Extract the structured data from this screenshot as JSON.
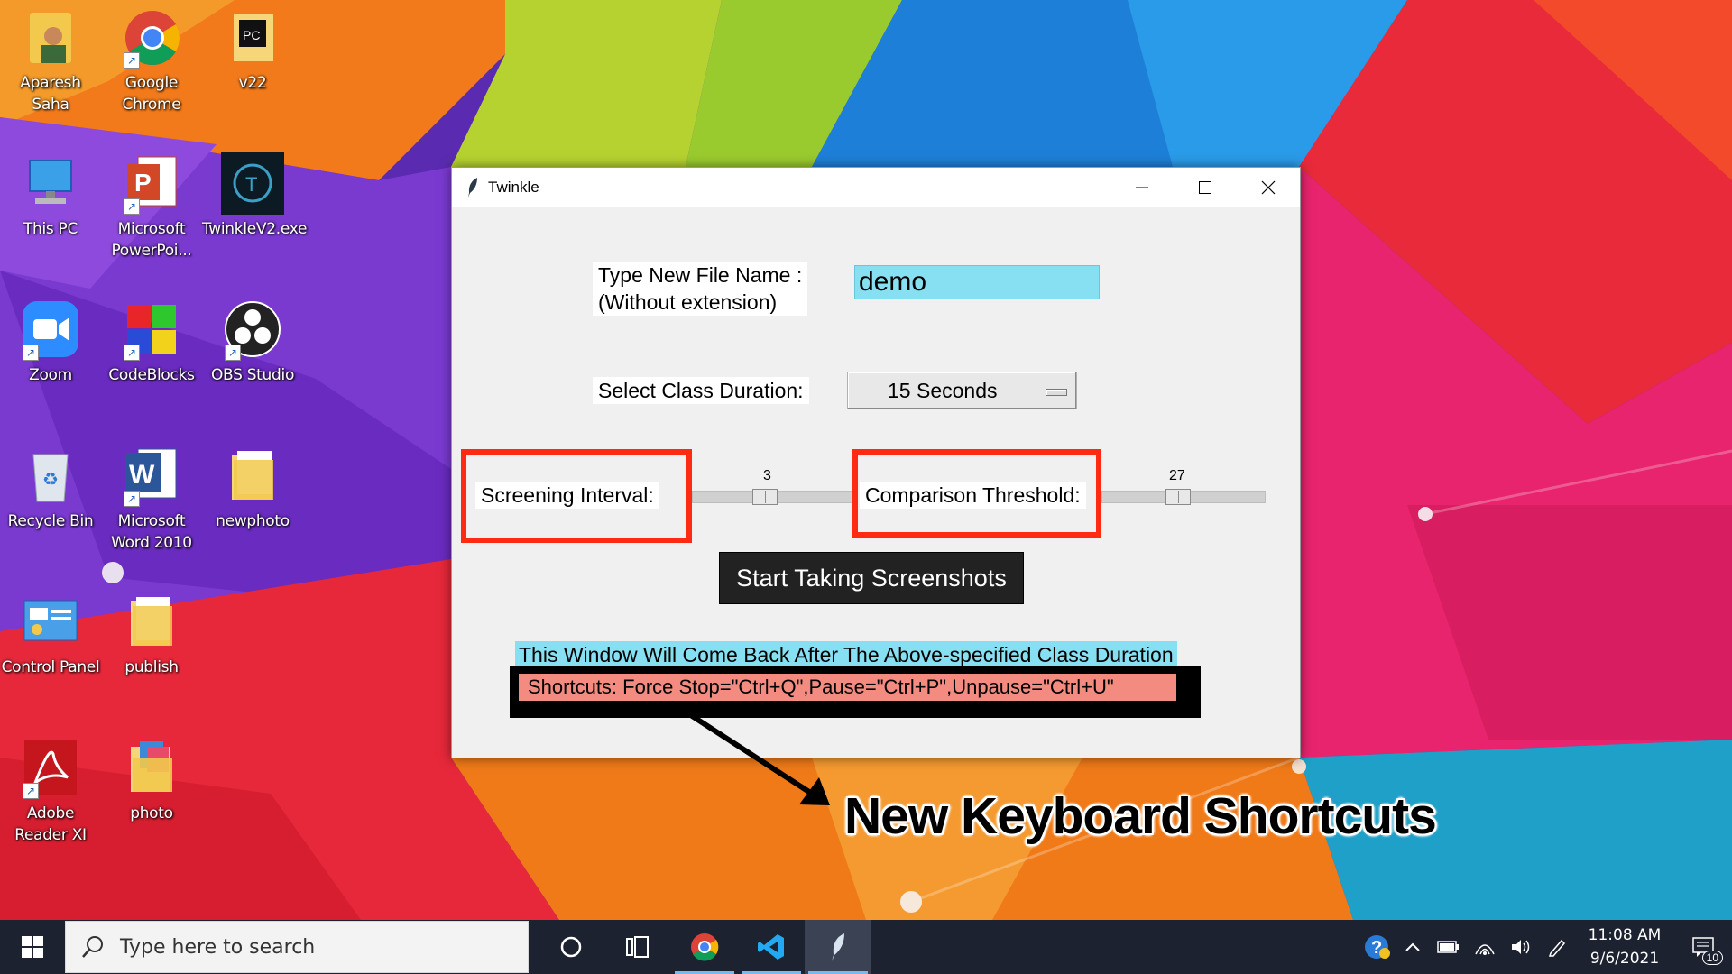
{
  "desktop": {
    "icons": [
      {
        "label_lines": [
          "Aparesh Saha"
        ]
      },
      {
        "label_lines": [
          "Google",
          "Chrome"
        ]
      },
      {
        "label_lines": [
          "v22"
        ]
      },
      {
        "label_lines": [
          "This PC"
        ]
      },
      {
        "label_lines": [
          "Microsoft",
          "PowerPoi..."
        ]
      },
      {
        "label_lines": [
          "TwinkleV2.exe"
        ]
      },
      {
        "label_lines": [
          "Zoom"
        ]
      },
      {
        "label_lines": [
          "CodeBlocks"
        ]
      },
      {
        "label_lines": [
          "OBS Studio"
        ]
      },
      {
        "label_lines": [
          "Recycle Bin"
        ]
      },
      {
        "label_lines": [
          "Microsoft",
          "Word 2010"
        ]
      },
      {
        "label_lines": [
          "newphoto"
        ]
      },
      {
        "label_lines": [
          "Control Panel"
        ]
      },
      {
        "label_lines": [
          "publish"
        ]
      },
      {
        "label_lines": [
          "Adobe",
          "Reader XI"
        ]
      },
      {
        "label_lines": [
          "photo"
        ]
      }
    ]
  },
  "window": {
    "title": "Twinkle",
    "filename_label_line1": "Type New File Name :",
    "filename_label_line2": "(Without extension)",
    "filename_value": "demo",
    "duration_label": "Select Class Duration:",
    "duration_value": "15 Seconds",
    "screening_label": "Screening Interval:",
    "screening_value": "3",
    "threshold_label": "Comparison Threshold:",
    "threshold_value": "27",
    "start_button": "Start Taking Screenshots",
    "info_text": "This Window Will Come Back After The Above-specified Class Duration",
    "shortcuts_text": "Shortcuts: Force Stop=\"Ctrl+Q\",Pause=\"Ctrl+P\",Unpause=\"Ctrl+U\""
  },
  "annotation": {
    "text": "New Keyboard Shortcuts"
  },
  "taskbar": {
    "search_placeholder": "Type here to search",
    "time": "11:08 AM",
    "date": "9/6/2021",
    "notification_count": "10"
  },
  "colors": {
    "input_bg": "#87dff2",
    "highlight_red": "#ff2a12",
    "shortcut_bg": "#f48b80",
    "taskbar_bg": "#1c2230"
  }
}
